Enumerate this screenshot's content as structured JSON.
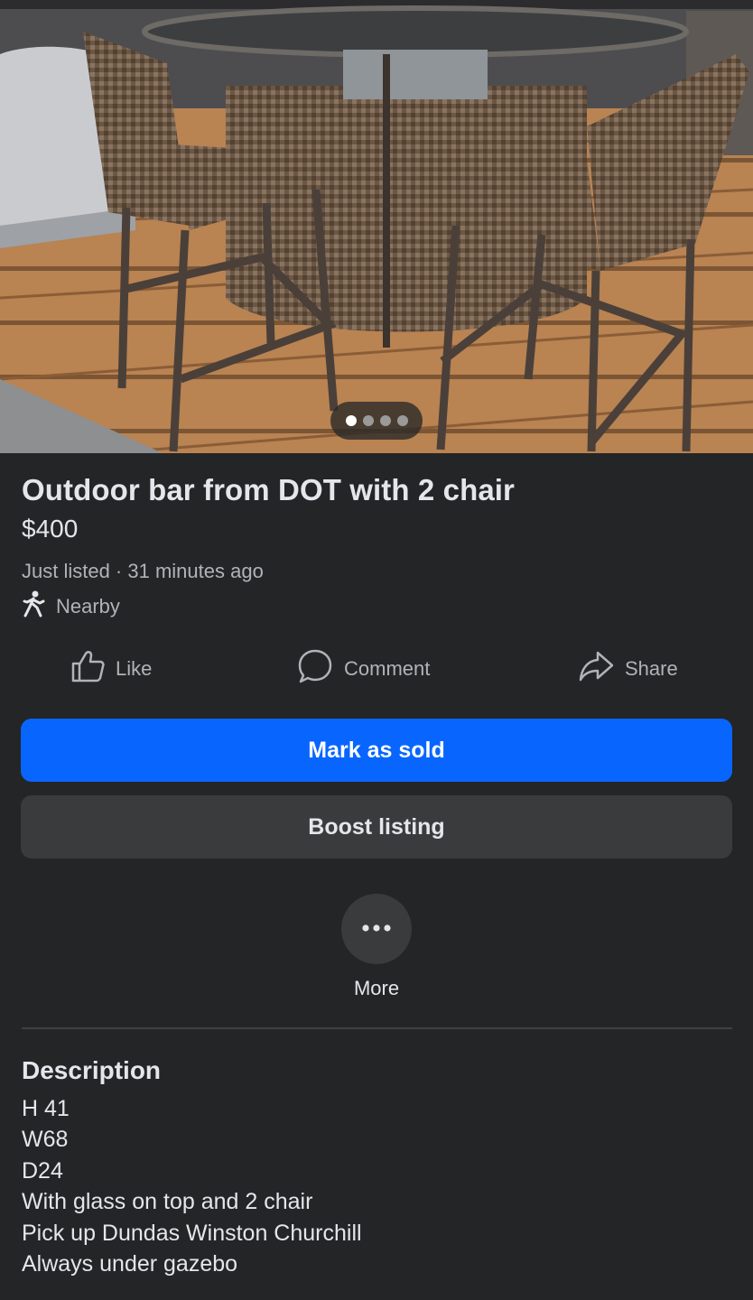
{
  "photo": {
    "alt": "Outdoor wicker bar with 2 stools",
    "slides": 4,
    "active_slide": 1
  },
  "listing": {
    "title": "Outdoor bar from DOT with 2 chair",
    "price": "$400",
    "meta": "Just listed · 31 minutes ago",
    "location": "Nearby",
    "location_icon": "walking-person-icon"
  },
  "actions": {
    "like": "Like",
    "comment": "Comment",
    "share": "Share"
  },
  "buttons": {
    "mark_sold": "Mark as sold",
    "boost": "Boost listing",
    "more": "More"
  },
  "description": {
    "heading": "Description",
    "lines": [
      "H 41",
      "W68",
      "D24",
      "With glass on top and 2 chair",
      "Pick up Dundas Winston Churchill",
      "Always under gazebo"
    ]
  },
  "colors": {
    "background": "#242526",
    "primary_button": "#0866ff",
    "secondary_button": "#3a3b3c",
    "secondary_text": "#b0b3b8"
  }
}
